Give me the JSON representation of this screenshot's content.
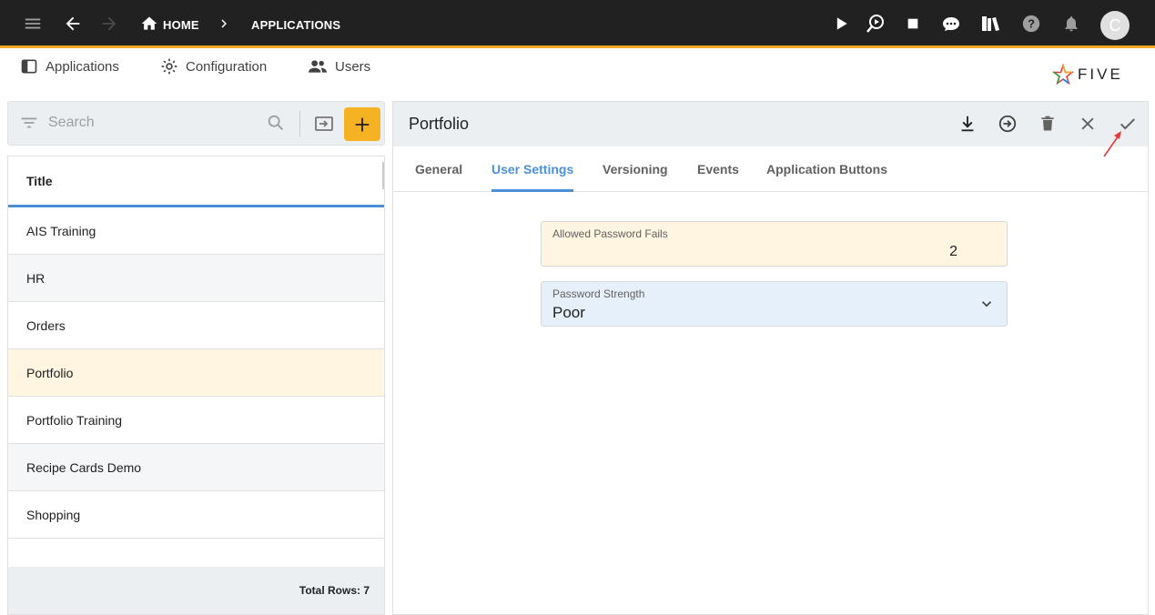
{
  "topbar": {
    "breadcrumbs": [
      {
        "label": "HOME",
        "icon": "home-icon"
      },
      {
        "label": "APPLICATIONS"
      }
    ],
    "avatar_initial": "C",
    "icons": [
      "menu-icon",
      "back-arrow-icon",
      "forward-arrow-icon",
      "play-icon",
      "debug-icon",
      "stop-icon",
      "chat-icon",
      "library-icon",
      "help-icon",
      "bell-icon"
    ]
  },
  "subnav": {
    "items": [
      {
        "label": "Applications",
        "icon": "applications-icon"
      },
      {
        "label": "Configuration",
        "icon": "gear-icon"
      },
      {
        "label": "Users",
        "icon": "users-icon"
      }
    ],
    "logo_text": "FIVE"
  },
  "list": {
    "search_placeholder": "Search",
    "column_title": "Title",
    "rows": [
      "AIS Training",
      "HR",
      "Orders",
      "Portfolio",
      "Portfolio Training",
      "Recipe Cards Demo",
      "Shopping"
    ],
    "selected_index": 3,
    "footer": "Total Rows: 7"
  },
  "form": {
    "title": "Portfolio",
    "tabs": [
      "General",
      "User Settings",
      "Versioning",
      "Events",
      "Application Buttons"
    ],
    "active_tab": "User Settings",
    "fields": {
      "allowed_password_fails": {
        "label": "Allowed Password Fails",
        "value": "2"
      },
      "password_strength": {
        "label": "Password Strength",
        "value": "Poor"
      }
    }
  },
  "colors": {
    "topbar": "#212121",
    "accent_orange": "#f5a623",
    "accent_blue": "#4a90d9",
    "selected_row": "#fff5e1",
    "field_yellow": "#fff5e1",
    "field_blue": "#e6f0fa",
    "annotation_red": "#e53935"
  }
}
